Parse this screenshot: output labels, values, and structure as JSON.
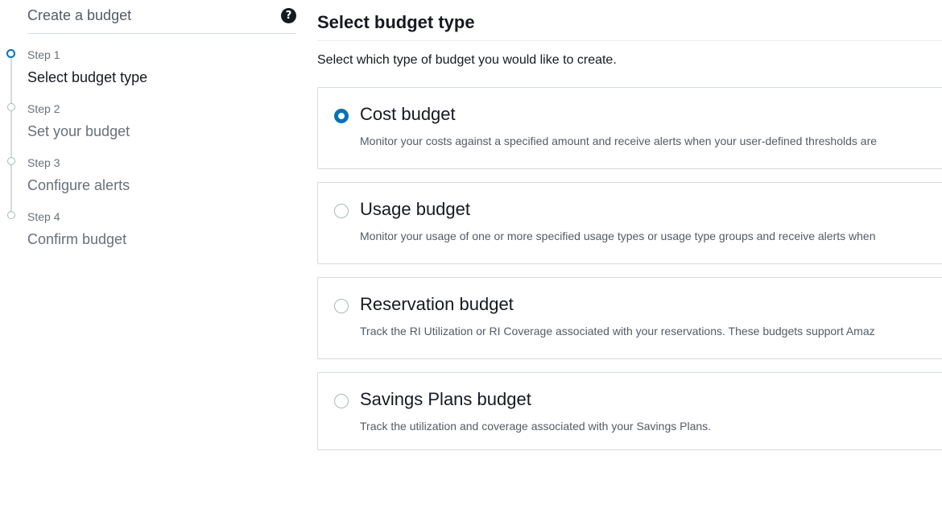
{
  "sidebar": {
    "title": "Create a budget",
    "help_icon": "question-circle-icon",
    "steps": [
      {
        "number": "Step 1",
        "label": "Select budget type",
        "active": true
      },
      {
        "number": "Step 2",
        "label": "Set your budget",
        "active": false
      },
      {
        "number": "Step 3",
        "label": "Configure alerts",
        "active": false
      },
      {
        "number": "Step 4",
        "label": "Confirm budget",
        "active": false
      }
    ]
  },
  "main": {
    "title": "Select budget type",
    "description": "Select which type of budget you would like to create.",
    "options": [
      {
        "title": "Cost budget",
        "description": "Monitor your costs against a specified amount and receive alerts when your user-defined thresholds are",
        "selected": true
      },
      {
        "title": "Usage budget",
        "description": "Monitor your usage of one or more specified usage types or usage type groups and receive alerts when",
        "selected": false
      },
      {
        "title": "Reservation budget",
        "description": "Track the RI Utilization or RI Coverage associated with your reservations. These budgets support Amaz",
        "selected": false
      },
      {
        "title": "Savings Plans budget",
        "description": "Track the utilization and coverage associated with your Savings Plans.",
        "selected": false
      }
    ]
  },
  "colors": {
    "accent": "#0073bb",
    "border": "#d5dbdb",
    "muted_text": "#687078"
  }
}
